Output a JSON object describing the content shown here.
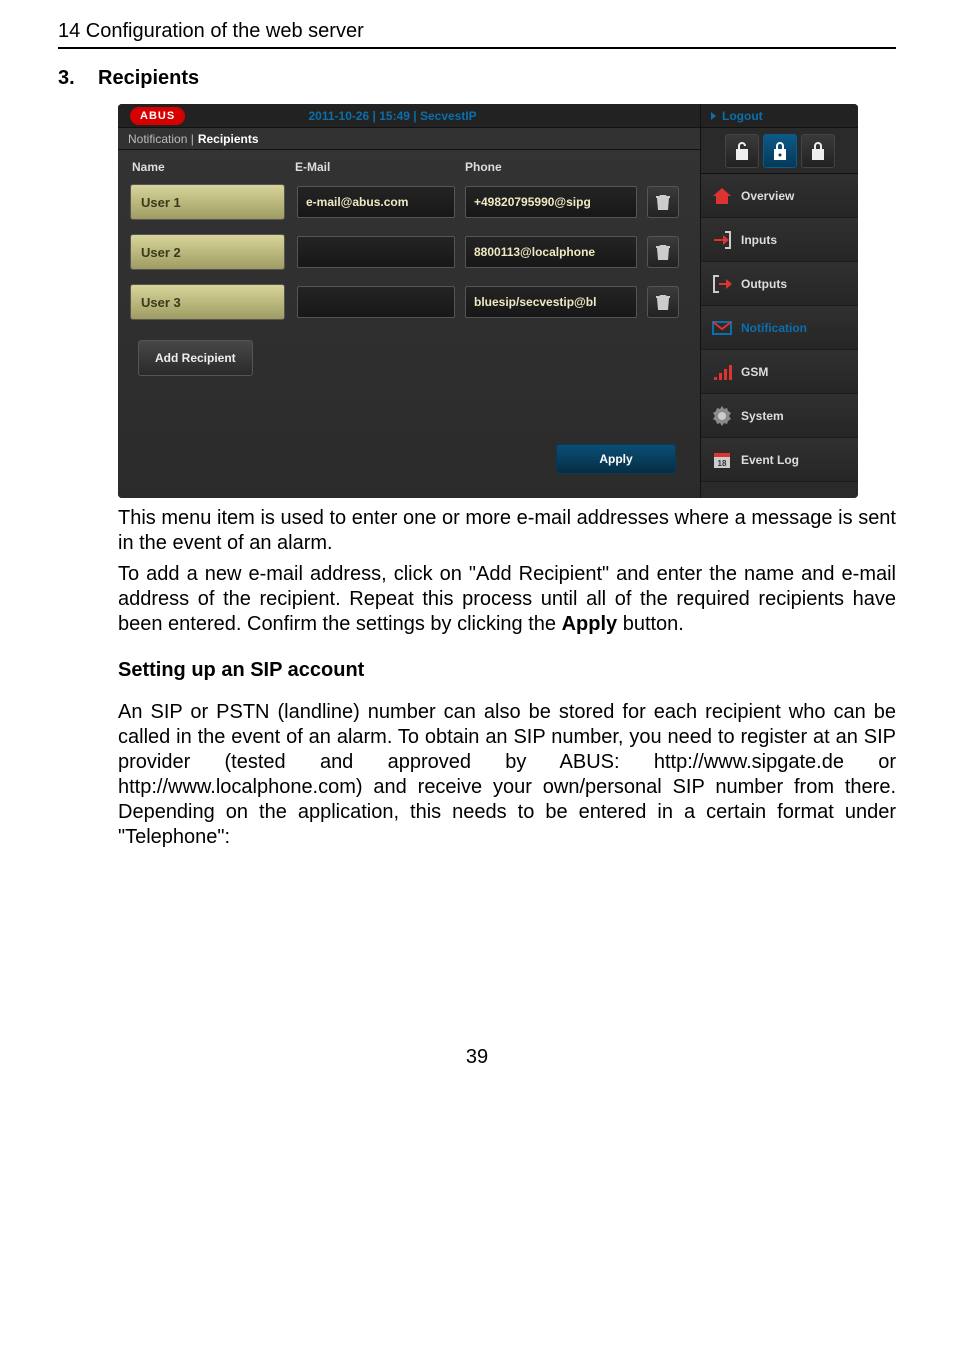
{
  "header": "14  Configuration of the web server",
  "section": {
    "num": "3.",
    "title": "Recipients"
  },
  "shot": {
    "brand": "ABUS",
    "topbar": "2011-10-26  |  15:49  |  SecvestIP",
    "logout": "Logout",
    "breadcrumb_prefix": "Notification | ",
    "breadcrumb_active": "Recipients",
    "columns": {
      "name": "Name",
      "email": "E-Mail",
      "phone": "Phone"
    },
    "rows": [
      {
        "name": "User 1",
        "email": "e-mail@abus.com",
        "phone": "+49820795990@sipg"
      },
      {
        "name": "User 2",
        "email": "",
        "phone": "8800113@localphone"
      },
      {
        "name": "User 3",
        "email": "",
        "phone": "bluesip/secvestip@bl"
      }
    ],
    "add": "Add Recipient",
    "apply": "Apply",
    "nav": {
      "overview": "Overview",
      "inputs": "Inputs",
      "outputs": "Outputs",
      "notification": "Notification",
      "gsm": "GSM",
      "system": "System",
      "eventlog": "Event Log"
    }
  },
  "paras": {
    "p1": "This menu item is used to enter one or more e-mail addresses where a message is sent in the event of an alarm.",
    "p2a": "To add a new e-mail address, click on \"Add Recipient\" and enter the name and e-mail address of the recipient. Repeat this process until all of the required recipients have been entered. Confirm the settings by clicking the ",
    "p2b": "Apply",
    "p2c": " button.",
    "sub": "Setting up an SIP account",
    "p3": "An SIP or PSTN (landline) number can also be stored for each recipient who can be called in the event of an alarm. To obtain an SIP number, you need to register at an SIP provider (tested and approved by ABUS: http://www.sipgate.de or http://www.localphone.com) and receive your own/personal SIP number from there. Depending on the application, this needs to be entered in a certain format under \"Telephone\":"
  },
  "page": "39"
}
